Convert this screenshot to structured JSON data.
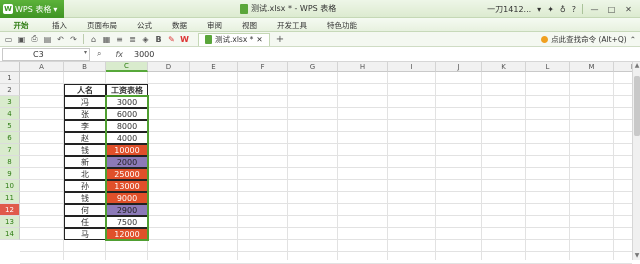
{
  "app": {
    "name": "WPS 表格",
    "logo": "W"
  },
  "window_title": "测试.xlsx * - WPS 表格",
  "user": "一刀1412...",
  "ribbon_tabs": [
    "开始",
    "插入",
    "页面布局",
    "公式",
    "数据",
    "审阅",
    "视图",
    "开发工具",
    "特色功能"
  ],
  "active_tab": "开始",
  "doc_tab": "测试.xlsx *",
  "search_command": "点此查找命令 (Alt+Q)",
  "formula_bar": {
    "cell_ref": "C3",
    "fx": "fx",
    "value": "3000"
  },
  "columns": [
    "A",
    "B",
    "C",
    "D",
    "E",
    "F",
    "G",
    "H",
    "I",
    "J",
    "K",
    "L",
    "M",
    "N"
  ],
  "rows": [
    "1",
    "2",
    "3",
    "4",
    "5",
    "6",
    "7",
    "8",
    "9",
    "10",
    "11",
    "12",
    "13",
    "14"
  ],
  "table": {
    "headers": [
      "人名",
      "工资表格"
    ],
    "data": [
      {
        "name": "冯",
        "salary": "3000",
        "fill": "none"
      },
      {
        "name": "张",
        "salary": "6000",
        "fill": "none"
      },
      {
        "name": "李",
        "salary": "8000",
        "fill": "none"
      },
      {
        "name": "赵",
        "salary": "4000",
        "fill": "none"
      },
      {
        "name": "钱",
        "salary": "10000",
        "fill": "red"
      },
      {
        "name": "新",
        "salary": "2000",
        "fill": "purple"
      },
      {
        "name": "北",
        "salary": "25000",
        "fill": "red"
      },
      {
        "name": "孙",
        "salary": "13000",
        "fill": "red"
      },
      {
        "name": "钱",
        "salary": "9000",
        "fill": "red"
      },
      {
        "name": "何",
        "salary": "2900",
        "fill": "purple"
      },
      {
        "name": "任",
        "salary": "7500",
        "fill": "none"
      },
      {
        "name": "马",
        "salary": "12000",
        "fill": "red"
      }
    ]
  },
  "colors": {
    "brand": "#3f9424",
    "highlight_red": "#e0502a",
    "highlight_purple": "#8c7ab8",
    "selection": "#4f9e31"
  }
}
